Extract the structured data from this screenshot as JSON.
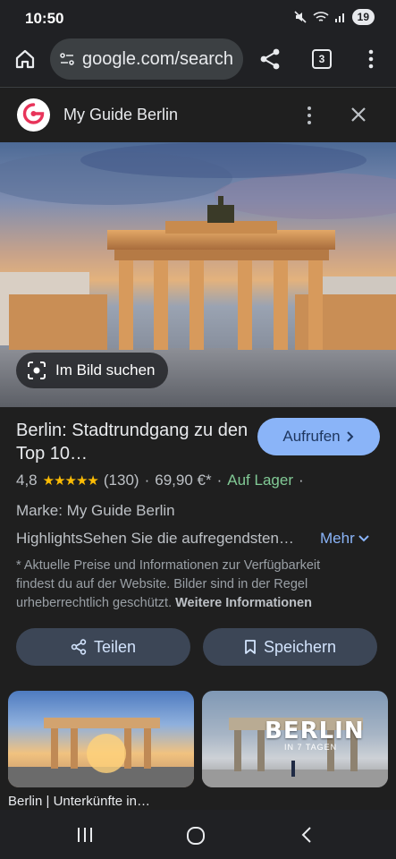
{
  "status_bar": {
    "time": "10:50",
    "battery": "19"
  },
  "browser": {
    "url": "google.com/search",
    "tab_count": "3"
  },
  "custom_tab": {
    "title": "My Guide Berlin"
  },
  "image_search": {
    "label": "Im Bild suchen"
  },
  "product": {
    "title": "Berlin: Stadtrundgang zu den Top 10…",
    "visit_label": "Aufrufen",
    "rating": "4,8",
    "stars": "★★★★★",
    "review_count": "(130)",
    "price": "69,90 €*",
    "availability": "Auf Lager",
    "brand": "Marke: My Guide Berlin",
    "highlights": "HighlightsSehen Sie die aufregendsten…",
    "more_label": "Mehr",
    "disclaimer": "* Aktuelle Preise und Informationen zur Verfügbarkeit findest du auf der Website. Bilder sind in der Regel urheberrechtlich geschützt.",
    "more_info_label": "Weitere Informationen"
  },
  "actions": {
    "share_label": "Teilen",
    "save_label": "Speichern"
  },
  "thumbnails": [
    {
      "caption": "Berlin | Unterkünfte in…"
    },
    {
      "overlay_title": "BERLIN",
      "overlay_sub": "IN 7 TAGEN"
    }
  ],
  "colors": {
    "accent": "#8ab4f8",
    "in_stock": "#81c995",
    "star": "#fbbc04",
    "logo_red": "#e8345a"
  }
}
